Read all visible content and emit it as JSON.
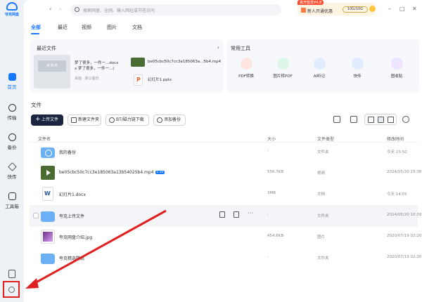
{
  "app": {
    "logo_text": "夸克网盘"
  },
  "sidebar": {
    "items": [
      {
        "label": "首页",
        "icon": "home-icon"
      },
      {
        "label": "传输",
        "icon": "transfer-icon"
      },
      {
        "label": "备份",
        "icon": "backup-icon"
      },
      {
        "label": "快传",
        "icon": "quick-send-icon"
      },
      {
        "label": "工具箱",
        "icon": "toolbox-icon"
      }
    ],
    "bottom_icons": [
      "phone-icon",
      "settings-icon"
    ]
  },
  "search": {
    "placeholder": "搜索网盘、全网、输入网址或书签访问"
  },
  "promo": {
    "tag": "真开能发¥4.8",
    "text": "新人开通优惠",
    "quota": "10G/10G"
  },
  "tabs": [
    "全部",
    "最近",
    "视频",
    "图片",
    "文档"
  ],
  "recent": {
    "title": "最近文件",
    "doc_title_1": "梦了很多，一件一...docx",
    "doc_title_2": "x 梦了很多，一件一...(",
    "doc_meta": "桌面 · 默认备份",
    "video_name": "be05cbc50c7cc3e185063a...5b4.mp4",
    "ppt_name": "幻灯片1.pptx"
  },
  "tools": {
    "title": "常用工具",
    "items": [
      {
        "label": "PDF转换",
        "color": "#ff6b4a"
      },
      {
        "label": "图片转PDF",
        "color": "#34c77b"
      },
      {
        "label": "AI听记",
        "color": "#4a8dff"
      },
      {
        "label": "快传",
        "color": "#2f7bff"
      },
      {
        "label": "图收贴",
        "color": "#9a6bff"
      }
    ]
  },
  "files": {
    "title": "文件",
    "buttons": {
      "upload": "上传文件",
      "new_folder": "新建文件夹",
      "bt_download": "BT/磁力链下载",
      "add_backup": "添加备份"
    },
    "columns": {
      "name": "文件名",
      "size": "大小",
      "type": "文件类型",
      "time": "修改时间"
    },
    "rows": [
      {
        "name": "我的备份",
        "badge": "",
        "size": "-",
        "type": "文件夹",
        "time": "今天 23:50",
        "icon": "backup-folder-icon"
      },
      {
        "name": "be05cbc50c7cc3e185063a13b54025b4.mp4",
        "badge": "1.2x",
        "size": "556.7KB",
        "type": "视频",
        "time": "2024/05/20 15:38",
        "icon": "video-file-icon"
      },
      {
        "name": "幻灯片1.docx",
        "badge": "",
        "size": "3MB",
        "type": "文档",
        "time": "今天 14:55",
        "icon": "word-file-icon"
      },
      {
        "name": "夸克上传文件",
        "badge": "",
        "size": "-",
        "type": "文件夹",
        "time": "2024/05/20 10:39",
        "icon": "folder-icon"
      },
      {
        "name": "夸克网盘介绍.jpg",
        "badge": "",
        "size": "454.6KB",
        "type": "图片",
        "time": "2020/07/19 02:20",
        "icon": "image-file-icon"
      },
      {
        "name": "夸克精选壁纸",
        "badge": "",
        "size": "-",
        "type": "文件夹",
        "time": "2020/07/19 02:20",
        "icon": "folder-icon"
      }
    ]
  },
  "colors": {
    "accent": "#1677ff",
    "highlight_box": "#e02020",
    "primary_button": "#1b2540"
  }
}
